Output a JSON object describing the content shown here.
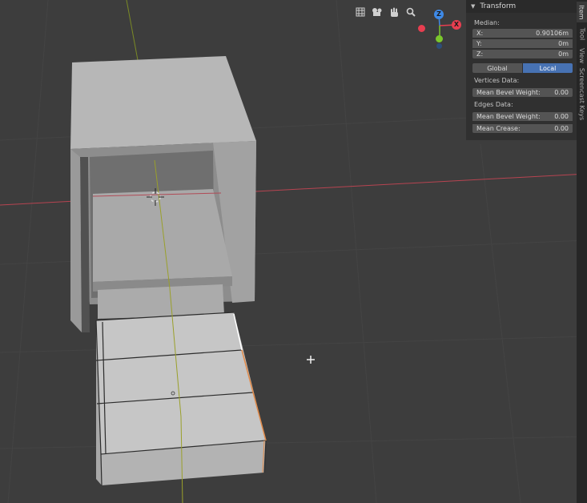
{
  "viewport": {
    "background": "#3d3d3d",
    "axis_x_color": "#b74451",
    "axis_y_color": "#7a8a26",
    "nav_icons": [
      "grid-perspective-icon",
      "camera-icon",
      "hand-pan-icon",
      "zoom-magnifier-icon"
    ],
    "gizmo": {
      "x_label": "X",
      "y_label": "Y",
      "z_label": "Z",
      "x_color": "#e83e50",
      "y_color": "#7bc72c",
      "z_color": "#3e8ae8"
    }
  },
  "sidebar": {
    "panel_title": "Transform",
    "median_label": "Median:",
    "fields": [
      {
        "label": "X:",
        "value": "0.90106m"
      },
      {
        "label": "Y:",
        "value": "0m"
      },
      {
        "label": "Z:",
        "value": "0m"
      }
    ],
    "space_toggle": {
      "options": [
        "Global",
        "Local"
      ],
      "selected": "Local"
    },
    "vertices_heading": "Vertices Data:",
    "vertex_bevel": {
      "label": "Mean Bevel Weight:",
      "value": "0.00"
    },
    "edges_heading": "Edges Data:",
    "edge_fields": [
      {
        "label": "Mean Bevel Weight:",
        "value": "0.00"
      },
      {
        "label": "Mean Crease:",
        "value": "0.00"
      }
    ],
    "tabs": [
      "Item",
      "Tool",
      "View",
      "Screencast Keys"
    ],
    "active_tab": "Item",
    "accent": "#4772b3"
  }
}
